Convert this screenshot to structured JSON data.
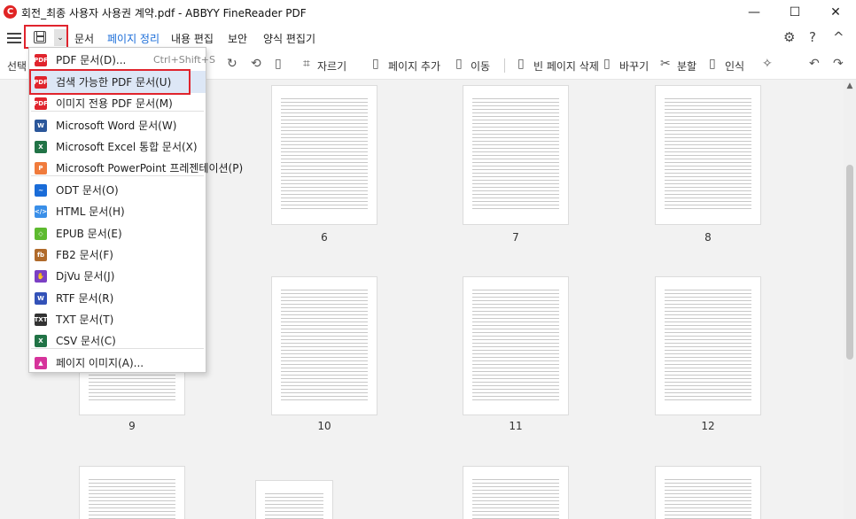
{
  "window": {
    "title": "회전_최종 사용자 사용권 계약.pdf - ABBYY FineReader PDF",
    "app_icon_letter": "C",
    "minimize": "—",
    "maximize": "☐",
    "close": "✕"
  },
  "menubar": {
    "items": [
      "문서",
      "페이지 정리",
      "내용 편집",
      "보안",
      "양식 편집기"
    ],
    "active_index": 1
  },
  "toolbar": {
    "select_label": "선택",
    "crop": "자르기",
    "add_page": "페이지 추가",
    "move": "이동",
    "delete_blank": "빈 페이지 삭제",
    "replace": "바꾸기",
    "split": "분할",
    "recognize": "인식"
  },
  "save_menu": {
    "items": [
      {
        "label": "PDF 문서(D)...",
        "shortcut": "Ctrl+Shift+S",
        "icon": "pdf-icon",
        "color": "#e0242d",
        "icon_text": "PDF"
      },
      {
        "label": "검색 가능한 PDF 문서(U)",
        "shortcut": "",
        "icon": "pdf-icon",
        "color": "#e0242d",
        "icon_text": "PDF"
      },
      {
        "label": "이미지 전용 PDF 문서(M)",
        "shortcut": "",
        "icon": "pdf-icon",
        "color": "#e0242d",
        "icon_text": "PDF"
      },
      {
        "label": "Microsoft Word 문서(W)",
        "shortcut": "",
        "icon": "word-icon",
        "color": "#2b579a",
        "icon_text": "W"
      },
      {
        "label": "Microsoft Excel 통합 문서(X)",
        "shortcut": "",
        "icon": "excel-icon",
        "color": "#217346",
        "icon_text": "X"
      },
      {
        "label": "Microsoft PowerPoint 프레젠테이션(P)",
        "shortcut": "",
        "icon": "powerpoint-icon",
        "color": "#f07b3c",
        "icon_text": "P"
      },
      {
        "label": "ODT 문서(O)",
        "shortcut": "",
        "icon": "odt-icon",
        "color": "#1a6cd8",
        "icon_text": "~"
      },
      {
        "label": "HTML 문서(H)",
        "shortcut": "",
        "icon": "html-icon",
        "color": "#3a8fe8",
        "icon_text": "</>"
      },
      {
        "label": "EPUB 문서(E)",
        "shortcut": "",
        "icon": "epub-icon",
        "color": "#5dba2f",
        "icon_text": "◇"
      },
      {
        "label": "FB2 문서(F)",
        "shortcut": "",
        "icon": "fb2-icon",
        "color": "#b06a2a",
        "icon_text": "fb"
      },
      {
        "label": "DjVu 문서(J)",
        "shortcut": "",
        "icon": "djvu-icon",
        "color": "#7b3fc4",
        "icon_text": "✋"
      },
      {
        "label": "RTF 문서(R)",
        "shortcut": "",
        "icon": "rtf-icon",
        "color": "#3352b8",
        "icon_text": "W"
      },
      {
        "label": "TXT 문서(T)",
        "shortcut": "",
        "icon": "txt-icon",
        "color": "#333333",
        "icon_text": "TXT"
      },
      {
        "label": "CSV 문서(C)",
        "shortcut": "",
        "icon": "csv-icon",
        "color": "#217346",
        "icon_text": "X"
      },
      {
        "label": "페이지 이미지(A)...",
        "shortcut": "",
        "icon": "image-icon",
        "color": "#d6339b",
        "icon_text": "▲"
      }
    ],
    "highlighted_index": 1
  },
  "pages": {
    "row1": [
      "6",
      "7",
      "8"
    ],
    "row2": [
      "9",
      "10",
      "11",
      "12"
    ]
  }
}
